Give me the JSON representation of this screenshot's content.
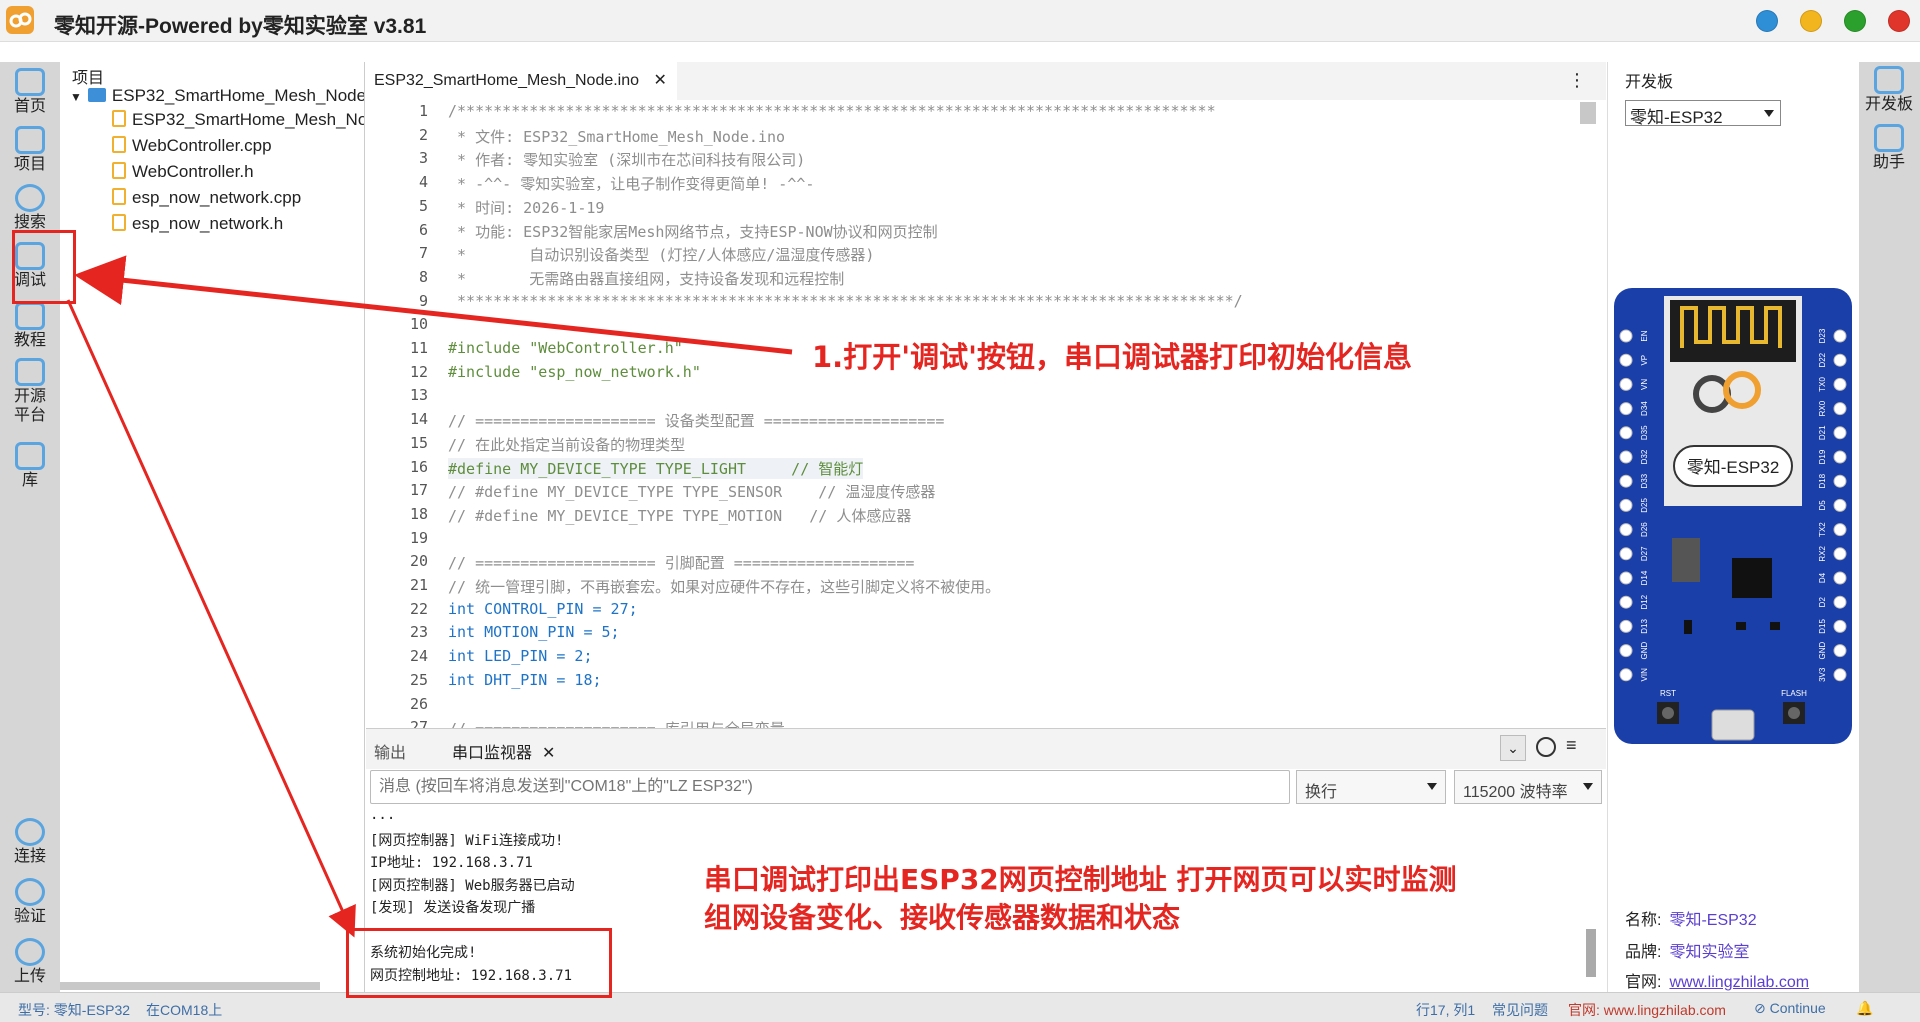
{
  "app": {
    "title": "零知开源-Powered by零知实验室 v3.81"
  },
  "left_nav": {
    "items": [
      {
        "label": "首页",
        "icon": "home-icon"
      },
      {
        "label": "项目",
        "icon": "project-icon"
      },
      {
        "label": "搜索",
        "icon": "search-icon"
      },
      {
        "label": "调试",
        "icon": "debug-icon"
      },
      {
        "label": "教程",
        "icon": "tutorial-icon"
      },
      {
        "label": "开源平台",
        "icon": "folder-icon"
      },
      {
        "label": "库",
        "icon": "library-icon"
      }
    ],
    "bottom_items": [
      {
        "label": "连接",
        "icon": "connect-icon"
      },
      {
        "label": "验证",
        "icon": "verify-icon"
      },
      {
        "label": "上传",
        "icon": "upload-icon"
      }
    ]
  },
  "project_panel": {
    "title": "项目",
    "folder": "ESP32_SmartHome_Mesh_Node",
    "files": [
      "ESP32_SmartHome_Mesh_Node.ino",
      "WebController.cpp",
      "WebController.h",
      "esp_now_network.cpp",
      "esp_now_network.h"
    ]
  },
  "editor": {
    "tab_label": "ESP32_SmartHome_Mesh_Node.ino",
    "lines": [
      "/************************************************************************************",
      " * 文件: ESP32_SmartHome_Mesh_Node.ino",
      " * 作者: 零知实验室 (深圳市在芯间科技有限公司)",
      " * -^^- 零知实验室，让电子制作变得更简单! -^^-",
      " * 时间: 2026-1-19",
      " * 功能: ESP32智能家居Mesh网络节点，支持ESP-NOW协议和网页控制",
      " *       自动识别设备类型 (灯控/人体感应/温湿度传感器)",
      " *       无需路由器直接组网，支持设备发现和远程控制",
      " **************************************************************************************/",
      "",
      "#include \"WebController.h\"",
      "#include \"esp_now_network.h\"",
      "",
      "// ==================== 设备类型配置 ====================",
      "// 在此处指定当前设备的物理类型",
      "#define MY_DEVICE_TYPE TYPE_LIGHT     // 智能灯",
      "// #define MY_DEVICE_TYPE TYPE_SENSOR    // 温湿度传感器",
      "// #define MY_DEVICE_TYPE TYPE_MOTION   // 人体感应器",
      "",
      "// ==================== 引脚配置 ====================",
      "// 统一管理引脚，不再嵌套宏。如果对应硬件不存在，这些引脚定义将不被使用。",
      "int CONTROL_PIN = 27;",
      "int MOTION_PIN = 5;",
      "int LED_PIN = 2;",
      "int DHT_PIN = 18;",
      "",
      "// ==================== 库引用与全局变量"
    ]
  },
  "serial_monitor": {
    "tab_output": "输出",
    "tab_serial": "串口监视器",
    "input_placeholder": "消息 (按回车将消息发送到\"COM18\"上的\"LZ ESP32\")",
    "line_ending": "换行",
    "baud": "115200 波特率",
    "log": [
      "...",
      "[网页控制器] WiFi连接成功!",
      "IP地址: 192.168.3.71",
      "[网页控制器] Web服务器已启动",
      "[发现] 发送设备发现广播",
      "",
      "系统初始化完成!",
      "网页控制地址: 192.168.3.71"
    ]
  },
  "board_panel": {
    "title": "开发板",
    "selected": "零知-ESP32",
    "board_label": "零知-ESP32",
    "pin_labels_left": [
      "EN",
      "VP",
      "VN",
      "D34",
      "D35",
      "D32",
      "D33",
      "D25",
      "D26",
      "D27",
      "D14",
      "D12",
      "D13",
      "GND",
      "VIN"
    ],
    "pin_labels_right": [
      "D23",
      "D22",
      "TX0",
      "RX0",
      "D21",
      "D19",
      "D18",
      "D5",
      "TX2",
      "RX2",
      "D4",
      "D2",
      "D15",
      "GND",
      "3V3"
    ],
    "button_labels": [
      "RST",
      "FLASH"
    ],
    "info": [
      {
        "key": "名称:",
        "value": "零知-ESP32"
      },
      {
        "key": "品牌:",
        "value": "零知实验室"
      },
      {
        "key": "官网:",
        "value": "www.lingzhilab.com"
      }
    ]
  },
  "right_nav": {
    "items": [
      {
        "label": "开发板",
        "icon": "board-icon"
      },
      {
        "label": "助手",
        "icon": "assistant-icon"
      }
    ]
  },
  "status_bar": {
    "model": "型号: 零知-ESP32",
    "port": "在COM18上",
    "cursor": "行17, 列1",
    "faq": "常见问题",
    "site": "官网: www.lingzhilab.com",
    "continue": "Continue"
  },
  "annotations": {
    "debug_tip": "1.打开'调试'按钮，串口调试器打印初始化信息",
    "serial_tip_line1": "串口调试打印出ESP32网页控制地址 打开网页可以实时监测",
    "serial_tip_line2": "组网设备变化、接收传感器数据和状态"
  },
  "colors": {
    "accent_blue": "#5aa5e0",
    "annotation_red": "#e52520",
    "board_blue": "#1b3fa8"
  }
}
